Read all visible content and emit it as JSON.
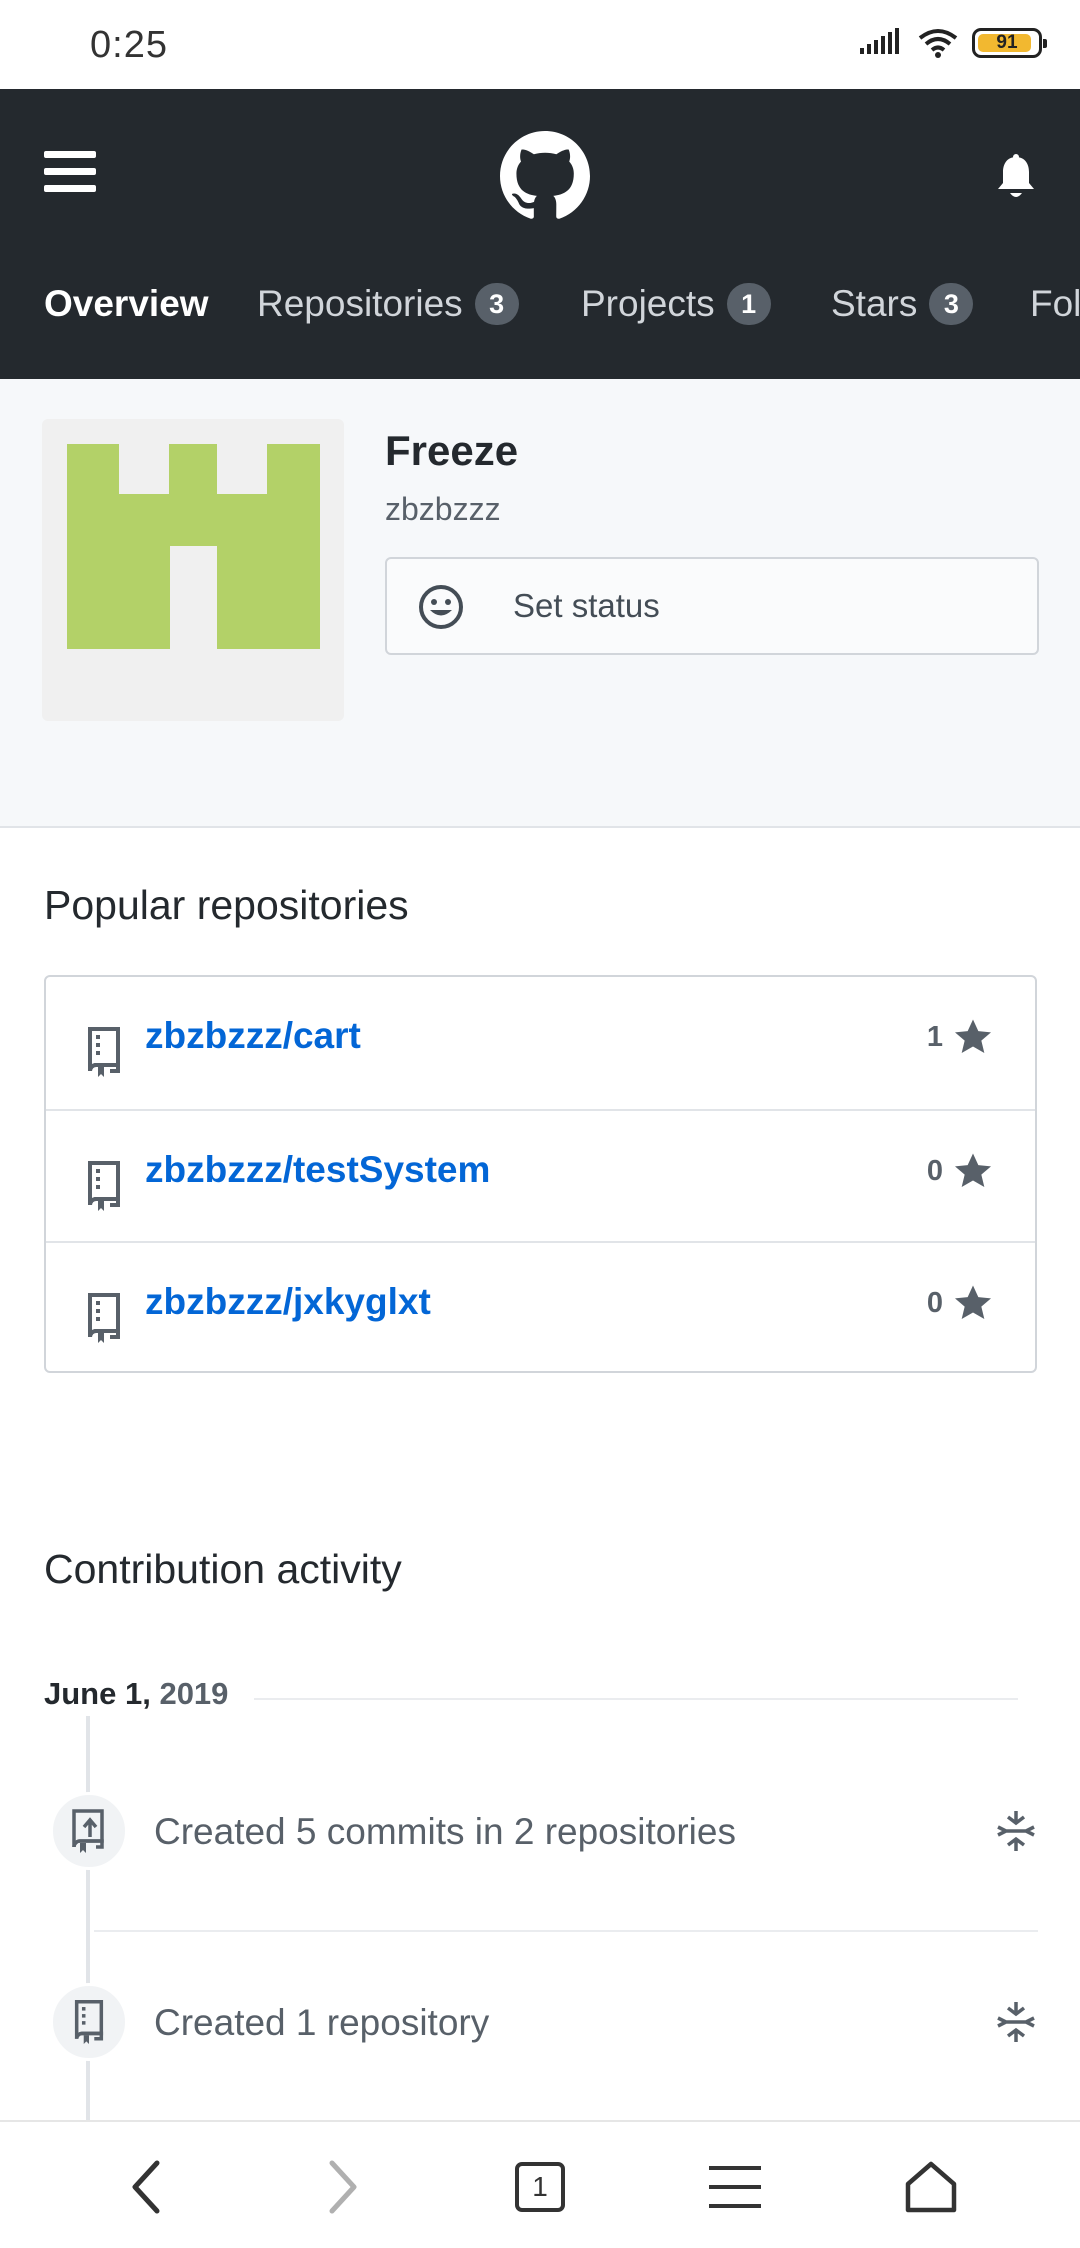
{
  "status_bar": {
    "time": "0:25",
    "battery": "91",
    "battery_level": 0.91,
    "icons": [
      "signal-icon",
      "wifi-icon",
      "battery-icon"
    ]
  },
  "header": {
    "icons": [
      "menu-icon",
      "github-logo-icon",
      "bell-icon"
    ],
    "tabs": [
      {
        "label": "Overview",
        "active": true
      },
      {
        "label": "Repositories",
        "count": "3"
      },
      {
        "label": "Projects",
        "count": "1"
      },
      {
        "label": "Stars",
        "count": "3"
      },
      {
        "label": "Fol"
      }
    ]
  },
  "profile": {
    "name": "Freeze",
    "login": "zbzbzzz",
    "set_status_label": "Set status",
    "avatar_color": "#b3d168"
  },
  "popular": {
    "title": "Popular repositories",
    "repos": [
      {
        "name": "zbzbzzz/cart",
        "stars": "1"
      },
      {
        "name": "zbzbzzz/testSystem",
        "stars": "0"
      },
      {
        "name": "zbzbzzz/jxkyglxt",
        "stars": "0"
      }
    ]
  },
  "contribution": {
    "title": "Contribution activity",
    "date_month_day": "June 1,",
    "date_year": "2019",
    "items": [
      {
        "text": "Created 5 commits in 2 repositories",
        "icon": "repo-push-icon"
      },
      {
        "text": "Created 1 repository",
        "icon": "repo-icon"
      }
    ]
  },
  "browser_bar": {
    "tab_count": "1",
    "icons": [
      "back-icon",
      "forward-icon",
      "tabs-icon",
      "menu-icon",
      "home-icon"
    ]
  },
  "colors": {
    "header_bg": "#24292e",
    "link": "#0366d6",
    "profile_bg": "#f6f8fa"
  }
}
